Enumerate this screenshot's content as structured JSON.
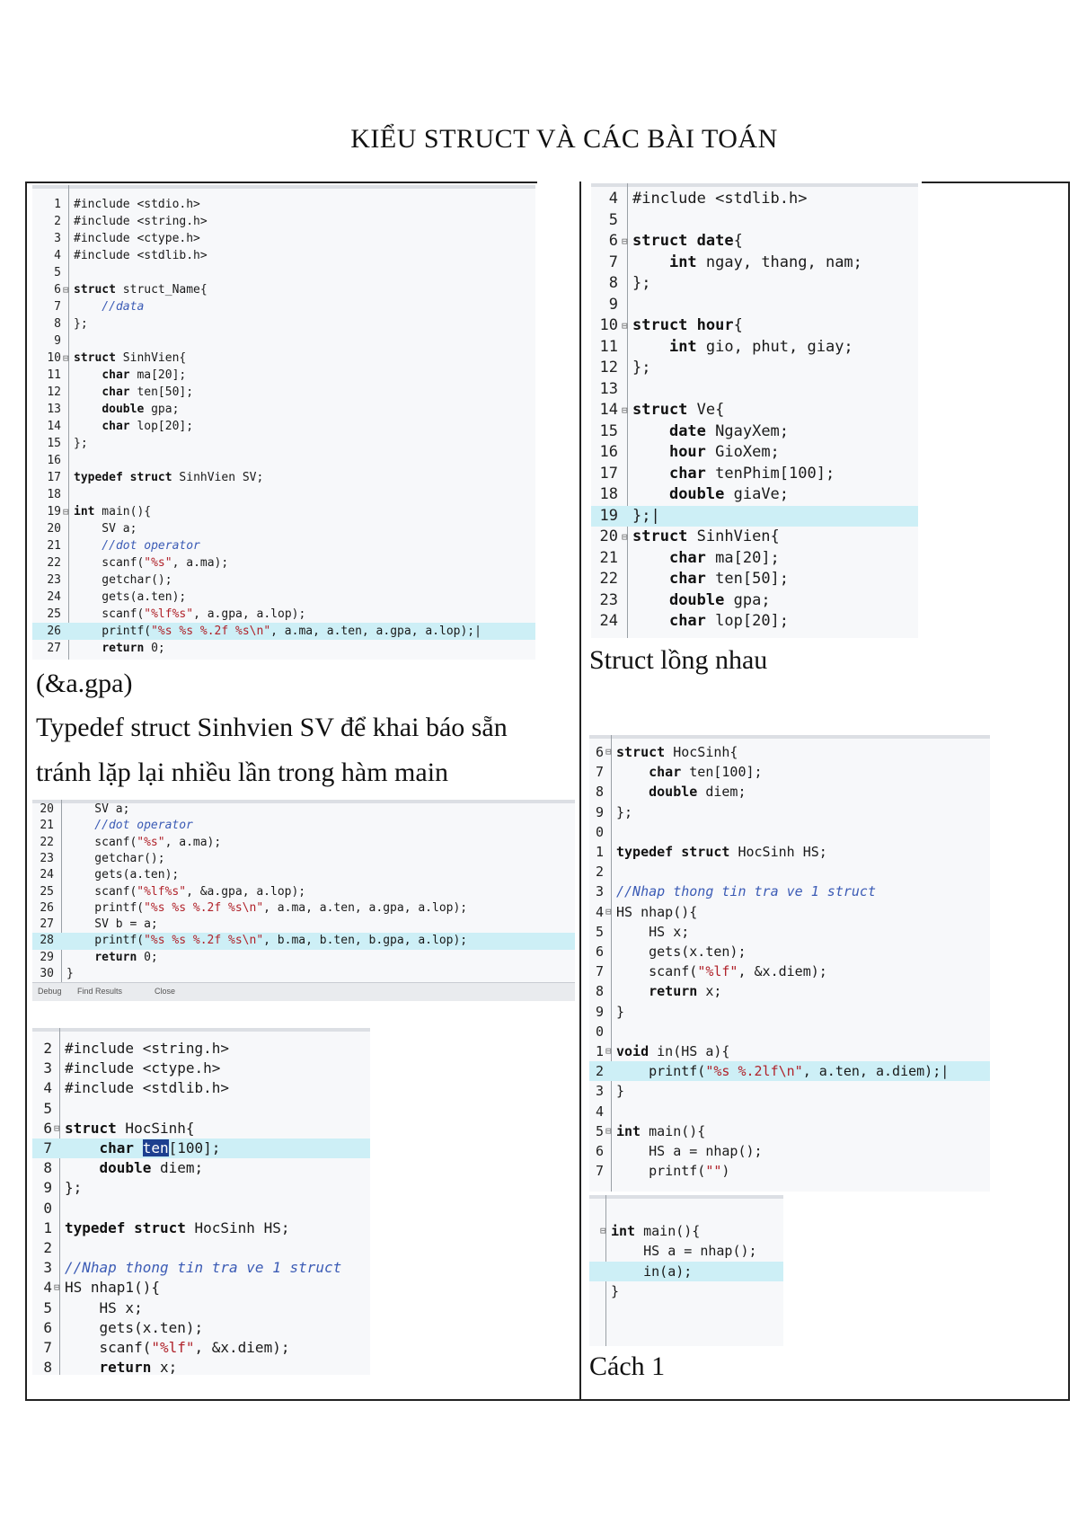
{
  "title": "KIỂU STRUCT VÀ CÁC BÀI TOÁN",
  "captions": {
    "gpa_note": "(&a.gpa)",
    "typedef_note_line1": "Typedef struct Sinhvien SV để khai báo sẵn",
    "typedef_note_line2": "tránh lặp lại nhiều lần trong hàm main",
    "nested": "Struct lồng nhau",
    "method1": "Cách 1"
  },
  "colors": {
    "highlight_line": "#cdeff6",
    "selection": "#1d3f8f",
    "keyword": "#111111"
  },
  "panels": {
    "p1": {
      "lines": [
        {
          "n": "1",
          "t": "#include <stdio.h>"
        },
        {
          "n": "2",
          "t": "#include <string.h>"
        },
        {
          "n": "3",
          "t": "#include <ctype.h>"
        },
        {
          "n": "4",
          "t": "#include <stdlib.h>"
        },
        {
          "n": "5",
          "t": ""
        },
        {
          "n": "6",
          "t": "struct struct_Name{"
        },
        {
          "n": "7",
          "t": "    //data"
        },
        {
          "n": "8",
          "t": "};"
        },
        {
          "n": "9",
          "t": ""
        },
        {
          "n": "10",
          "t": "struct SinhVien{"
        },
        {
          "n": "11",
          "t": "    char ma[20];"
        },
        {
          "n": "12",
          "t": "    char ten[50];"
        },
        {
          "n": "13",
          "t": "    double gpa;"
        },
        {
          "n": "14",
          "t": "    char lop[20];"
        },
        {
          "n": "15",
          "t": "};"
        },
        {
          "n": "16",
          "t": ""
        },
        {
          "n": "17",
          "t": "typedef struct SinhVien SV;"
        },
        {
          "n": "18",
          "t": ""
        },
        {
          "n": "19",
          "t": "int main(){"
        },
        {
          "n": "20",
          "t": "    SV a;"
        },
        {
          "n": "21",
          "t": "    //dot operator"
        },
        {
          "n": "22",
          "t": "    scanf(\"%s\", a.ma);"
        },
        {
          "n": "23",
          "t": "    getchar();"
        },
        {
          "n": "24",
          "t": "    gets(a.ten);"
        },
        {
          "n": "25",
          "t": "    scanf(\"%lf%s\", a.gpa, a.lop);"
        },
        {
          "n": "26",
          "t": "    printf(\"%s %s %.2f %s\\n\", a.ma, a.ten, a.gpa, a.lop);|"
        },
        {
          "n": "27",
          "t": "    return 0;"
        }
      ]
    },
    "p2": {
      "lines": [
        {
          "n": "4",
          "t": "#include <stdlib.h>"
        },
        {
          "n": "5",
          "t": ""
        },
        {
          "n": "6",
          "t": "struct date{"
        },
        {
          "n": "7",
          "t": "    int ngay, thang, nam;"
        },
        {
          "n": "8",
          "t": "};"
        },
        {
          "n": "9",
          "t": ""
        },
        {
          "n": "10",
          "t": "struct hour{"
        },
        {
          "n": "11",
          "t": "    int gio, phut, giay;"
        },
        {
          "n": "12",
          "t": "};"
        },
        {
          "n": "13",
          "t": ""
        },
        {
          "n": "14",
          "t": "struct Ve{"
        },
        {
          "n": "15",
          "t": "    date NgayXem;"
        },
        {
          "n": "16",
          "t": "    hour GioXem;"
        },
        {
          "n": "17",
          "t": "    char tenPhim[100];"
        },
        {
          "n": "18",
          "t": "    double giaVe;"
        },
        {
          "n": "19",
          "t": "};|"
        },
        {
          "n": "20",
          "t": "struct SinhVien{"
        },
        {
          "n": "21",
          "t": "    char ma[20];"
        },
        {
          "n": "22",
          "t": "    char ten[50];"
        },
        {
          "n": "23",
          "t": "    double gpa;"
        },
        {
          "n": "24",
          "t": "    char lop[20];"
        }
      ]
    },
    "p3": {
      "lines": [
        {
          "n": "20",
          "t": "    SV a;"
        },
        {
          "n": "21",
          "t": "    //dot operator"
        },
        {
          "n": "22",
          "t": "    scanf(\"%s\", a.ma);"
        },
        {
          "n": "23",
          "t": "    getchar();"
        },
        {
          "n": "24",
          "t": "    gets(a.ten);"
        },
        {
          "n": "25",
          "t": "    scanf(\"%lf%s\", &a.gpa, a.lop);"
        },
        {
          "n": "26",
          "t": "    printf(\"%s %s %.2f %s\\n\", a.ma, a.ten, a.gpa, a.lop);"
        },
        {
          "n": "27",
          "t": "    SV b = a;"
        },
        {
          "n": "28",
          "t": "    printf(\"%s %s %.2f %s\\n\", b.ma, b.ten, b.gpa, a.lop);"
        },
        {
          "n": "29",
          "t": "    return 0;"
        },
        {
          "n": "30",
          "t": "}"
        }
      ],
      "status_tabs": [
        "Debug",
        "Find Results",
        "Close"
      ]
    },
    "p4": {
      "lines": [
        {
          "n": "2",
          "t": "#include <string.h>"
        },
        {
          "n": "3",
          "t": "#include <ctype.h>"
        },
        {
          "n": "4",
          "t": "#include <stdlib.h>"
        },
        {
          "n": "5",
          "t": ""
        },
        {
          "n": "6",
          "t": "struct HocSinh{"
        },
        {
          "n": "7",
          "t": "    char ten[100];"
        },
        {
          "n": "8",
          "t": "    double diem;"
        },
        {
          "n": "9",
          "t": "};"
        },
        {
          "n": "0",
          "t": ""
        },
        {
          "n": "1",
          "t": "typedef struct HocSinh HS;"
        },
        {
          "n": "2",
          "t": ""
        },
        {
          "n": "3",
          "t": "//Nhap thong tin tra ve 1 struct"
        },
        {
          "n": "4",
          "t": "HS nhap1(){"
        },
        {
          "n": "5",
          "t": "    HS x;"
        },
        {
          "n": "6",
          "t": "    gets(x.ten);"
        },
        {
          "n": "7",
          "t": "    scanf(\"%lf\", &x.diem);"
        },
        {
          "n": "8",
          "t": "    return x;"
        }
      ]
    },
    "p5": {
      "lines": [
        {
          "n": "6",
          "t": "struct HocSinh{"
        },
        {
          "n": "7",
          "t": "    char ten[100];"
        },
        {
          "n": "8",
          "t": "    double diem;"
        },
        {
          "n": "9",
          "t": "};"
        },
        {
          "n": "0",
          "t": ""
        },
        {
          "n": "1",
          "t": "typedef struct HocSinh HS;"
        },
        {
          "n": "2",
          "t": ""
        },
        {
          "n": "3",
          "t": "//Nhap thong tin tra ve 1 struct"
        },
        {
          "n": "4",
          "t": "HS nhap(){"
        },
        {
          "n": "5",
          "t": "    HS x;"
        },
        {
          "n": "6",
          "t": "    gets(x.ten);"
        },
        {
          "n": "7",
          "t": "    scanf(\"%lf\", &x.diem);"
        },
        {
          "n": "8",
          "t": "    return x;"
        },
        {
          "n": "9",
          "t": "}"
        },
        {
          "n": "0",
          "t": ""
        },
        {
          "n": "1",
          "t": "void in(HS a){"
        },
        {
          "n": "2",
          "t": "    printf(\"%s %.2lf\\n\", a.ten, a.diem);|"
        },
        {
          "n": "3",
          "t": "}"
        },
        {
          "n": "4",
          "t": ""
        },
        {
          "n": "5",
          "t": "int main(){"
        },
        {
          "n": "6",
          "t": "    HS a = nhap();"
        },
        {
          "n": "7",
          "t": "    printf(\"\")"
        }
      ]
    },
    "p6": {
      "lines": [
        {
          "n": "",
          "t": ""
        },
        {
          "n": "",
          "t": "int main(){"
        },
        {
          "n": "",
          "t": "    HS a = nhap();"
        },
        {
          "n": "",
          "t": "    in(a);"
        },
        {
          "n": "",
          "t": "}"
        },
        {
          "n": "",
          "t": ""
        },
        {
          "n": "",
          "t": ""
        }
      ]
    }
  }
}
